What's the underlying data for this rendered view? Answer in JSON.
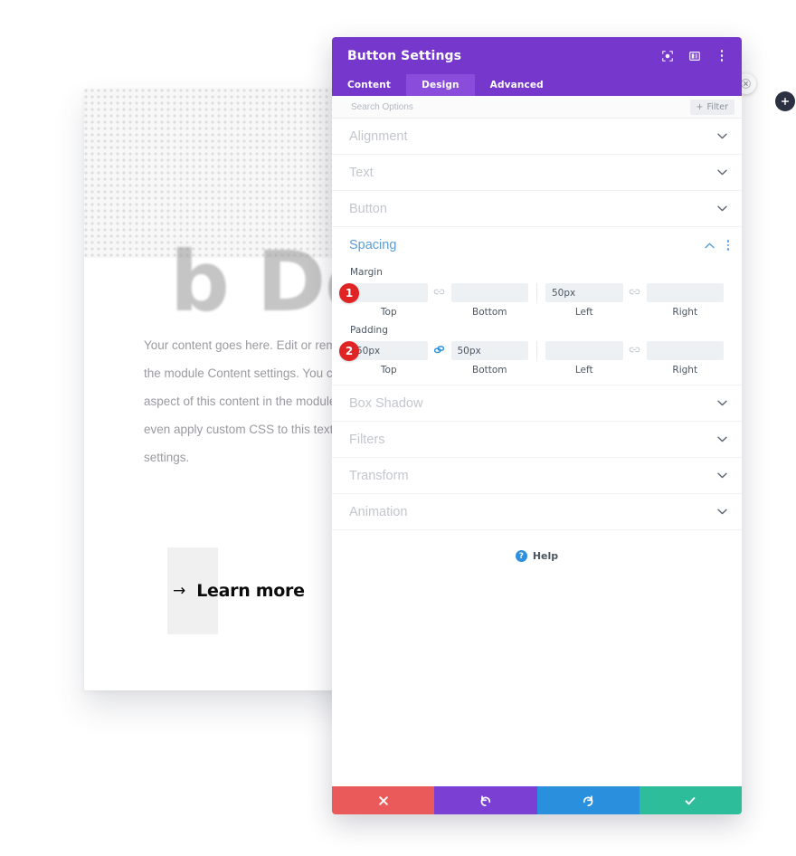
{
  "background": {
    "placeholder_word": "b Des",
    "body_text": "Your content goes here. Edit or remove this text inline or in the module Content settings. You can also style every aspect of this content in the module Design settings and even apply custom CSS to this text in the module Advanced settings.",
    "cta_arrow": "→",
    "cta_label": "Learn more"
  },
  "floating": {
    "close_icon": "close-icon",
    "add_icon": "plus-icon"
  },
  "modal": {
    "title": "Button Settings",
    "header_icons": [
      "target-icon",
      "layout-panel-icon",
      "kebab-menu-icon"
    ],
    "tabs": [
      {
        "label": "Content",
        "active": false
      },
      {
        "label": "Design",
        "active": true
      },
      {
        "label": "Advanced",
        "active": false
      }
    ],
    "search": {
      "placeholder": "Search Options",
      "value": "",
      "filter_label": "Filter",
      "filter_plus": "+"
    },
    "sections_before": [
      {
        "label": "Alignment"
      },
      {
        "label": "Text"
      },
      {
        "label": "Button"
      }
    ],
    "spacing": {
      "title": "Spacing",
      "collapse_icon": "chevron-up-icon",
      "menu_icon": "kebab-menu-icon",
      "margin": {
        "label": "Margin",
        "badge": "1",
        "link_left_icon": "chain-unlinked-icon",
        "link_right_icon": "chain-unlinked-icon",
        "fields": [
          {
            "caption": "Top",
            "value": ""
          },
          {
            "caption": "Bottom",
            "value": ""
          },
          {
            "caption": "Left",
            "value": "50px"
          },
          {
            "caption": "Right",
            "value": ""
          }
        ]
      },
      "padding": {
        "label": "Padding",
        "badge": "2",
        "link_left_icon": "chain-linked-icon",
        "link_right_icon": "chain-unlinked-icon",
        "fields": [
          {
            "caption": "Top",
            "value": "50px"
          },
          {
            "caption": "Bottom",
            "value": "50px"
          },
          {
            "caption": "Left",
            "value": ""
          },
          {
            "caption": "Right",
            "value": ""
          }
        ]
      }
    },
    "sections_after": [
      {
        "label": "Box Shadow"
      },
      {
        "label": "Filters"
      },
      {
        "label": "Transform"
      },
      {
        "label": "Animation"
      }
    ],
    "help": {
      "glyph": "?",
      "label": "Help"
    },
    "footer": [
      {
        "name": "cancel",
        "icon": "close-icon",
        "color": "#eb5a5a"
      },
      {
        "name": "undo",
        "icon": "undo-icon",
        "color": "#7b3fd4"
      },
      {
        "name": "redo",
        "icon": "redo-icon",
        "color": "#2a8fdc"
      },
      {
        "name": "save",
        "icon": "checkmark-icon",
        "color": "#2ebd9a"
      }
    ]
  },
  "colors": {
    "brand_purple": "#7638cc",
    "tab_active": "#8a4ddb",
    "section_blue": "#5b9dd9",
    "badge_red": "#e02424"
  }
}
